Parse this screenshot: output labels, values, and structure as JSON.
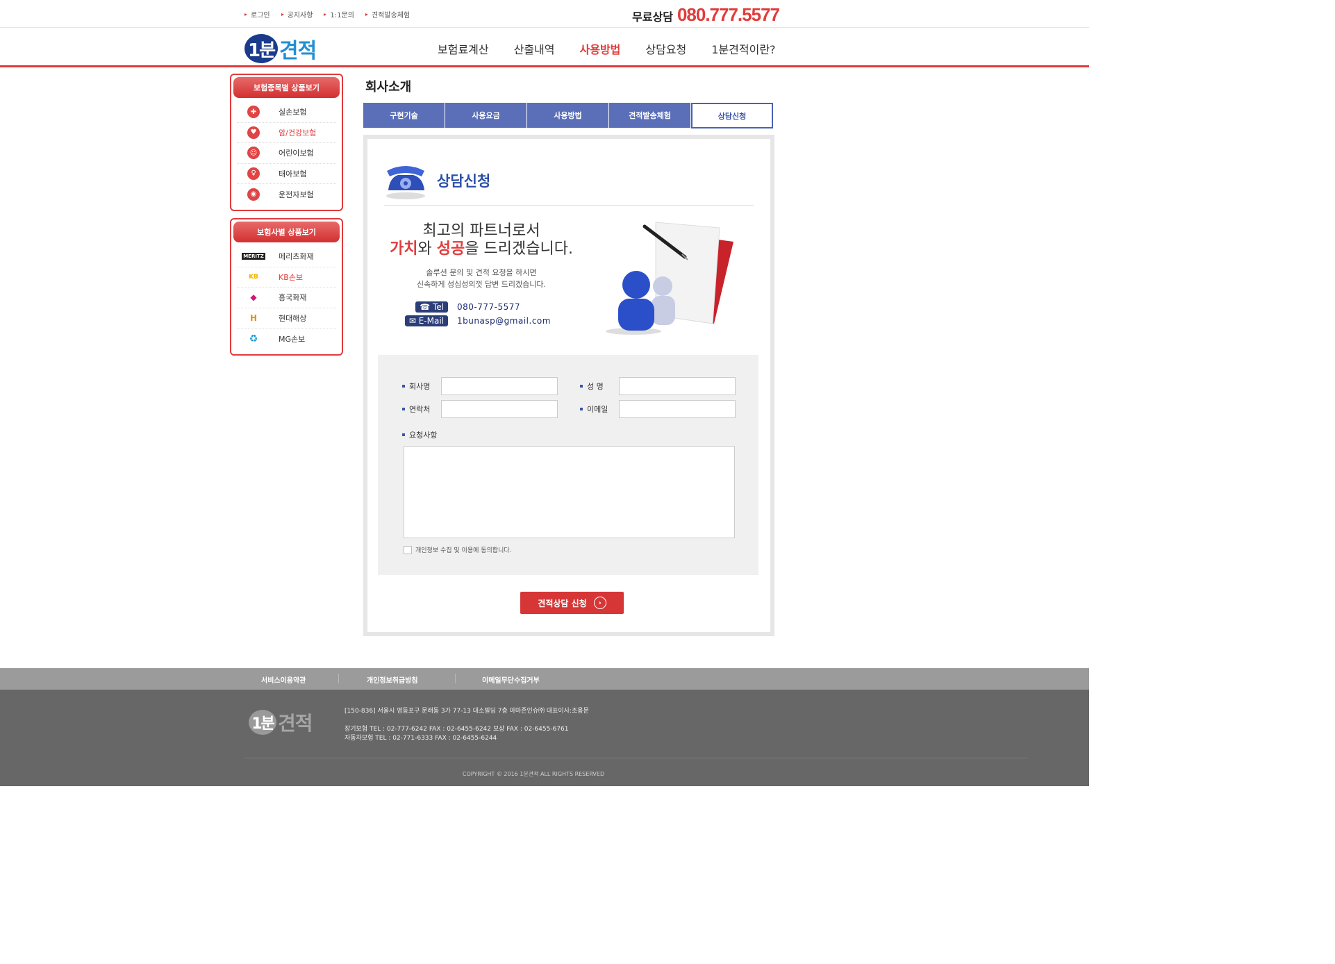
{
  "util": {
    "links": [
      "로그인",
      "공지사항",
      "1:1문의",
      "견적발송체험"
    ],
    "hotline_label": "무료상담",
    "hotline_number": "080.777.5577"
  },
  "header": {
    "logo_num": "1분",
    "logo_word": "견적",
    "nav": [
      "보험료계산",
      "산출내역",
      "사용방법",
      "상담요청",
      "1분견적이란?"
    ],
    "active_nav": "사용방법"
  },
  "sidebar": {
    "box1": {
      "title": "보험종목별 상품보기",
      "items": [
        "실손보험",
        "암/건강보험",
        "어린이보험",
        "태아보험",
        "운전자보험"
      ]
    },
    "box2": {
      "title": "보험사별 상품보기",
      "items": [
        "메리츠화재",
        "KB손보",
        "흥국화재",
        "현대해상",
        "MG손보"
      ],
      "brand_marks": [
        "MERITZ",
        "KB",
        "◆",
        "H",
        "♻"
      ]
    }
  },
  "main": {
    "page_title": "회사소개",
    "tabs": [
      "구현기술",
      "사용요금",
      "사용방법",
      "견적발송체험",
      "상담신청"
    ],
    "section_title": "상담신청",
    "promo": {
      "line1": "최고의 파트너로서",
      "value_word": "가치",
      "and": "와 ",
      "success_word": "성공",
      "line2_rest": "을 드리겠습니다.",
      "sub1": "솔루션 문의 및 견적 요청을 하시면",
      "sub2": "신속하게 성심성의껏 답변 드리겠습니다.",
      "tel_label": "☎ Tel",
      "tel_value": "080-777-5577",
      "email_label": "✉ E-Mail",
      "email_value": "1bunasp@gmail.com"
    },
    "form": {
      "company_label": "회사명",
      "name_label": "성   명",
      "phone_label": "연락처",
      "email_label": "이메일",
      "request_label": "요청사항",
      "agree_text": "개인정보 수집 및 이용에 동의합니다.",
      "submit_label": "견적상담 신청"
    }
  },
  "footer": {
    "links": [
      "서비스이용약관",
      "개인정보취급방침",
      "이메일무단수집거부"
    ],
    "logo_num": "1분",
    "logo_word": "견적",
    "address": "[150-836] 서울시 영등포구 문래동 3가 77-13 대소빌딩 7층 아마존인슈㈜ 대표이사:조용문",
    "line2": "장기보험 TEL : 02-777-6242 FAX : 02-6455-6242 보상 FAX : 02-6455-6761",
    "line3": "자동차보험 TEL : 02-771-6333 FAX : 02-6455-6244",
    "copyright": "COPYRIGHT © 2016 1분견적 ALL RIGHTS RESERVED"
  },
  "colors": {
    "accent_red": "#e23b3b",
    "nav_blue": "#5a6fb8",
    "title_blue": "#2a4fa8"
  }
}
